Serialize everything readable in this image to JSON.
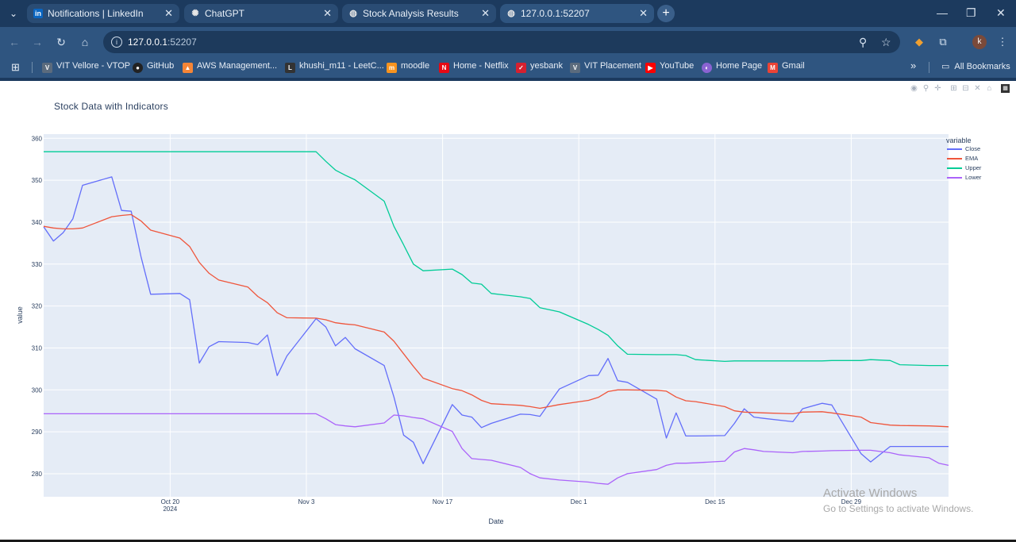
{
  "browser": {
    "tabs": [
      {
        "title": "Notifications | LinkedIn",
        "icon": "in",
        "color": "#0a66c2"
      },
      {
        "title": "ChatGPT",
        "icon": "chatgpt-icon",
        "color": "#e6e6e6"
      },
      {
        "title": "Stock Analysis Results",
        "icon": "globe-icon",
        "color": "#e6e6e6"
      },
      {
        "title": "127.0.0.1:52207",
        "icon": "globe-icon",
        "color": "#e6e6e6"
      }
    ],
    "url_host": "127.0.0.1",
    "url_port": ":52207",
    "profile_initial": "k",
    "bookmarks": [
      {
        "label": "VIT Vellore - VTOP",
        "color": "#5b6b7d"
      },
      {
        "label": "GitHub",
        "color": "#222222"
      },
      {
        "label": "AWS Management...",
        "color": "#f58536"
      },
      {
        "label": "khushi_m11 - LeetC...",
        "color": "#222222"
      },
      {
        "label": "moodle",
        "color": "#f7931e"
      },
      {
        "label": "Home - Netflix",
        "color": "#e50914"
      },
      {
        "label": "yesbank",
        "color": "#d6202f"
      },
      {
        "label": "VIT Placement",
        "color": "#5b6b7d"
      },
      {
        "label": "YouTube",
        "color": "#ff0000"
      },
      {
        "label": "Home Page",
        "color": "#8a63d2"
      },
      {
        "label": "Gmail",
        "color": "#ea4335"
      }
    ],
    "more_bookmarks": "»",
    "all_bookmarks": "All Bookmarks"
  },
  "watermark": {
    "line1": "Activate Windows",
    "line2": "Go to Settings to activate Windows."
  },
  "chart_data": {
    "type": "line",
    "title": "Stock Data with Indicators",
    "xlabel": "Date",
    "ylabel": "value",
    "legend_title": "variable",
    "legend_position": "right",
    "grid": true,
    "ylim": [
      274.5,
      361
    ],
    "x_ticks": [
      "Oct 20",
      "Nov 3",
      "Nov 17",
      "Dec 1",
      "Dec 15",
      "Dec 29"
    ],
    "x_tick_sub": [
      "2024",
      "",
      "",
      "",
      "",
      ""
    ],
    "y_ticks": [
      280,
      290,
      300,
      310,
      320,
      330,
      340,
      350,
      360
    ],
    "x": [
      "2024-10-07",
      "2024-10-08",
      "2024-10-09",
      "2024-10-10",
      "2024-10-11",
      "2024-10-14",
      "2024-10-15",
      "2024-10-16",
      "2024-10-17",
      "2024-10-18",
      "2024-10-21",
      "2024-10-22",
      "2024-10-23",
      "2024-10-24",
      "2024-10-25",
      "2024-10-28",
      "2024-10-29",
      "2024-10-30",
      "2024-10-31",
      "2024-11-01",
      "2024-11-04",
      "2024-11-05",
      "2024-11-06",
      "2024-11-07",
      "2024-11-08",
      "2024-11-11",
      "2024-11-12",
      "2024-11-13",
      "2024-11-14",
      "2024-11-15",
      "2024-11-18",
      "2024-11-19",
      "2024-11-20",
      "2024-11-21",
      "2024-11-22",
      "2024-11-25",
      "2024-11-26",
      "2024-11-27",
      "2024-11-29",
      "2024-12-02",
      "2024-12-03",
      "2024-12-04",
      "2024-12-05",
      "2024-12-06",
      "2024-12-09",
      "2024-12-10",
      "2024-12-11",
      "2024-12-12",
      "2024-12-13",
      "2024-12-16",
      "2024-12-17",
      "2024-12-18",
      "2024-12-19",
      "2024-12-20",
      "2024-12-23",
      "2024-12-24",
      "2024-12-26",
      "2024-12-27",
      "2024-12-30",
      "2024-12-31",
      "2025-01-02",
      "2025-01-03",
      "2025-01-06",
      "2025-01-07",
      "2025-01-08"
    ],
    "series": [
      {
        "name": "Close",
        "color": "#636efa",
        "values": [
          338.9,
          335.5,
          337.5,
          340.8,
          348.8,
          350.8,
          342.8,
          342.6,
          331.8,
          322.8,
          323.0,
          321.5,
          306.4,
          310.3,
          311.5,
          311.3,
          310.8,
          313.1,
          303.4,
          308.1,
          317.0,
          315.0,
          310.5,
          312.5,
          309.8,
          305.8,
          298.3,
          289.2,
          287.5,
          282.4,
          296.5,
          294.0,
          293.5,
          291.0,
          292.0,
          294.2,
          294.1,
          293.7,
          300.2,
          303.4,
          303.5,
          307.5,
          302.2,
          301.8,
          297.8,
          288.5,
          294.5,
          289.0,
          289.0,
          289.1,
          292.0,
          295.5,
          293.5,
          293.2,
          292.4,
          295.5,
          296.8,
          296.4,
          284.8,
          282.8,
          286.5,
          286.5,
          286.5,
          286.5,
          286.5
        ]
      },
      {
        "name": "EMA",
        "color": "#ef553b",
        "values": [
          339.0,
          338.6,
          338.4,
          338.4,
          338.6,
          341.3,
          341.6,
          341.8,
          340.3,
          338.1,
          336.2,
          334.2,
          330.4,
          327.8,
          326.2,
          324.5,
          322.3,
          320.8,
          318.4,
          317.2,
          317.1,
          316.7,
          316.0,
          315.7,
          315.5,
          313.8,
          311.6,
          308.6,
          305.6,
          302.8,
          300.3,
          299.8,
          298.8,
          297.5,
          296.7,
          296.3,
          296.0,
          295.6,
          296.5,
          297.5,
          298.2,
          299.6,
          300.0,
          300.0,
          299.9,
          299.7,
          298.3,
          297.4,
          297.2,
          296.0,
          295.0,
          294.7,
          294.6,
          294.5,
          294.3,
          294.7,
          294.8,
          294.5,
          293.5,
          292.2,
          291.6,
          291.5,
          291.4,
          291.3,
          291.2
        ]
      },
      {
        "name": "Upper",
        "color": "#00cc96",
        "values": [
          356.8,
          356.8,
          356.8,
          356.8,
          356.8,
          356.8,
          356.8,
          356.8,
          356.8,
          356.8,
          356.8,
          356.8,
          356.8,
          356.8,
          356.8,
          356.8,
          356.8,
          356.8,
          356.8,
          356.8,
          356.8,
          354.5,
          352.4,
          351.2,
          350.1,
          345.0,
          339.0,
          334.6,
          330.0,
          328.4,
          328.8,
          327.5,
          325.5,
          325.2,
          323.0,
          322.2,
          321.8,
          319.6,
          318.6,
          315.6,
          314.4,
          313.0,
          310.5,
          308.5,
          308.4,
          308.4,
          308.4,
          308.2,
          307.2,
          306.8,
          306.9,
          306.9,
          306.9,
          306.9,
          306.9,
          306.9,
          306.9,
          307.0,
          307.0,
          307.2,
          307.0,
          306.0,
          305.8,
          305.8,
          305.8
        ]
      },
      {
        "name": "Lower",
        "color": "#ab63fa",
        "values": [
          294.3,
          294.3,
          294.3,
          294.3,
          294.3,
          294.3,
          294.3,
          294.3,
          294.3,
          294.3,
          294.3,
          294.3,
          294.3,
          294.3,
          294.3,
          294.3,
          294.3,
          294.3,
          294.3,
          294.3,
          294.3,
          293.1,
          291.7,
          291.4,
          291.2,
          292.1,
          294.0,
          293.8,
          293.4,
          293.1,
          290.1,
          286.0,
          283.6,
          283.4,
          283.2,
          281.5,
          280.0,
          279.0,
          278.5,
          278.0,
          277.7,
          277.5,
          279.0,
          280.0,
          281.0,
          282.0,
          282.5,
          282.5,
          282.6,
          283.0,
          285.2,
          286.0,
          285.7,
          285.3,
          285.0,
          285.3,
          285.4,
          285.5,
          285.6,
          285.6,
          285.0,
          284.5,
          283.8,
          282.5,
          282.0
        ]
      }
    ]
  }
}
